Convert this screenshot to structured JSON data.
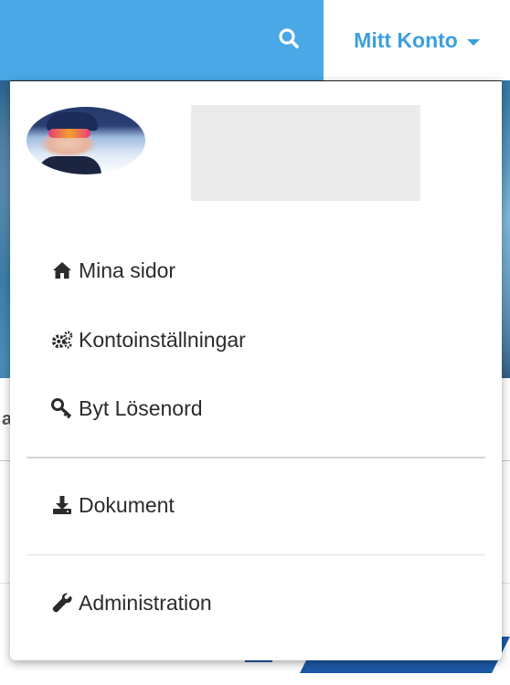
{
  "header": {
    "account_label": "Mitt Konto",
    "search_icon": "search-icon",
    "accent_color": "#4aa8e6"
  },
  "background": {
    "partial_letter": "a"
  },
  "dropdown": {
    "menu": [
      {
        "label": "Mina sidor",
        "icon": "home-icon"
      },
      {
        "label": "Kontoinställningar",
        "icon": "gears-icon"
      },
      {
        "label": "Byt Lösenord",
        "icon": "key-icon"
      }
    ],
    "documents": {
      "label": "Dokument",
      "icon": "download-icon"
    },
    "admin": {
      "label": "Administration",
      "icon": "wrench-icon"
    }
  }
}
